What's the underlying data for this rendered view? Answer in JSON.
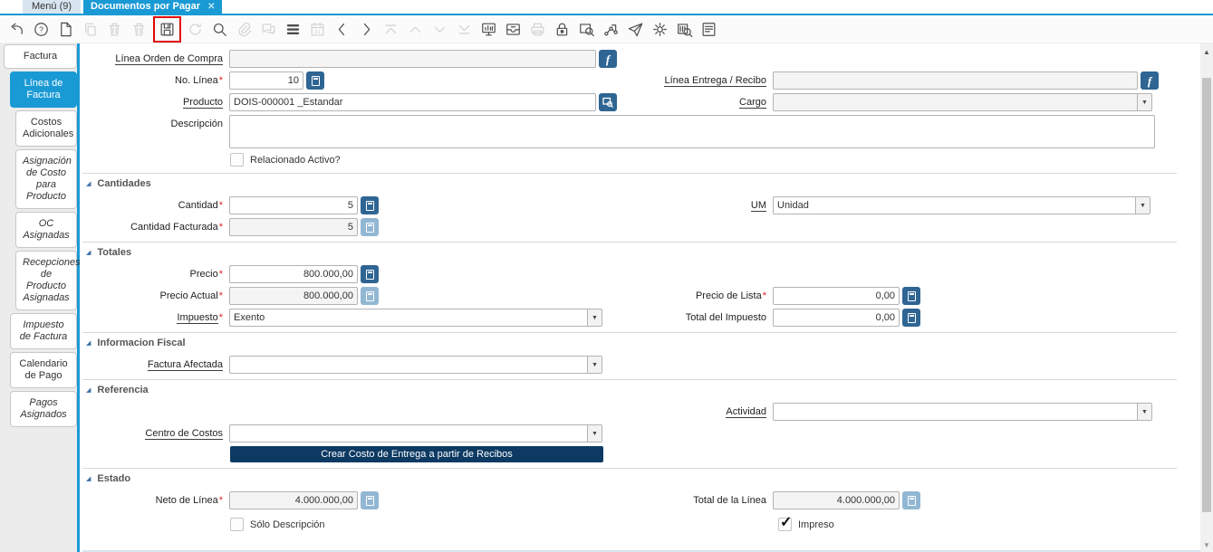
{
  "ui": {
    "close_glyph": "✕",
    "required_marker": "*",
    "check_glyph": "✓",
    "collapse_glyph": "◢",
    "combo_arrow": "▼",
    "scroll_up_glyph": "▲",
    "scroll_down_glyph": "▼",
    "zoom_button_glyph": "f"
  },
  "colors": {
    "accent_blue": "#1a9ad5",
    "field_button_blue": "#2f6593",
    "field_button_blue_disabled": "#92b7d3",
    "action_button_navy": "#0d3a63",
    "save_highlight_red": "#e00909"
  },
  "window_tabs": [
    {
      "label": "Menú (9)",
      "active": false
    },
    {
      "label": "Documentos por Pagar",
      "active": true,
      "closable": true
    }
  ],
  "toolbar": {
    "icons": [
      {
        "name": "undo-icon",
        "key": "undo",
        "enabled": true
      },
      {
        "name": "help-icon",
        "key": "help",
        "enabled": true
      },
      {
        "name": "new-record-icon",
        "key": "new",
        "enabled": true
      },
      {
        "name": "copy-record-icon",
        "key": "copy",
        "enabled": false
      },
      {
        "name": "delete-record-icon",
        "key": "delete",
        "enabled": false
      },
      {
        "name": "delete-selection-icon",
        "key": "delete",
        "enabled": false
      },
      {
        "name": "save-icon",
        "key": "save",
        "enabled": true,
        "highlighted": true
      },
      {
        "name": "refresh-icon",
        "key": "refresh",
        "enabled": false
      },
      {
        "name": "find-icon",
        "key": "find",
        "enabled": true
      },
      {
        "name": "attachment-icon",
        "key": "attachment",
        "enabled": false
      },
      {
        "name": "chat-icon",
        "key": "chat",
        "enabled": false
      },
      {
        "name": "grid-toggle-icon",
        "key": "grid",
        "enabled": true
      },
      {
        "name": "calendar-icon",
        "key": "calendar",
        "enabled": false
      },
      {
        "name": "parent-record-icon",
        "key": "parent",
        "enabled": true
      },
      {
        "name": "detail-record-icon",
        "key": "detail",
        "enabled": true
      },
      {
        "name": "first-record-icon",
        "key": "first",
        "enabled": false
      },
      {
        "name": "previous-record-icon",
        "key": "prev",
        "enabled": false
      },
      {
        "name": "next-record-icon",
        "key": "next",
        "enabled": false
      },
      {
        "name": "last-record-icon",
        "key": "last",
        "enabled": false
      },
      {
        "name": "report-icon",
        "key": "report",
        "enabled": true
      },
      {
        "name": "archive-icon",
        "key": "archive",
        "enabled": true
      },
      {
        "name": "print-icon",
        "key": "print",
        "enabled": false
      },
      {
        "name": "lock-icon",
        "key": "lock",
        "enabled": true
      },
      {
        "name": "zoom-across-icon",
        "key": "zoomacross",
        "enabled": true
      },
      {
        "name": "workflow-icon",
        "key": "workflow",
        "enabled": true
      },
      {
        "name": "send-icon",
        "key": "send",
        "enabled": true
      },
      {
        "name": "process-icon",
        "key": "process",
        "enabled": true
      },
      {
        "name": "product-info-icon",
        "key": "productinfo",
        "enabled": true
      },
      {
        "name": "report-design-icon",
        "key": "reportdoc",
        "enabled": true
      }
    ]
  },
  "sidebar": {
    "tabs": [
      {
        "label": "Factura",
        "level": 0,
        "active": false,
        "italic": false
      },
      {
        "label": "Línea de Factura",
        "level": 1,
        "active": true,
        "italic": false
      },
      {
        "label": "Costos Adicionales",
        "level": 2,
        "active": false,
        "italic": false
      },
      {
        "label": "Asignación de Costo para Producto",
        "level": 2,
        "active": false,
        "italic": true
      },
      {
        "label": "OC Asignadas",
        "level": 2,
        "active": false,
        "italic": true
      },
      {
        "label": "Recepciones de Producto Asignadas",
        "level": 2,
        "active": false,
        "italic": true
      },
      {
        "label": "Impuesto de Factura",
        "level": 1,
        "active": false,
        "italic": true
      },
      {
        "label": "Calendario de Pago",
        "level": 1,
        "active": false,
        "italic": false
      },
      {
        "label": "Pagos Asignados",
        "level": 1,
        "active": false,
        "italic": true
      }
    ]
  },
  "form": {
    "sections": {
      "cantidades": "Cantidades",
      "totales": "Totales",
      "informacion_fiscal": "Informacion Fiscal",
      "referencia": "Referencia",
      "estado": "Estado"
    },
    "fields": {
      "linea_orden_compra": {
        "label": "Línea Orden de Compra",
        "value": ""
      },
      "no_linea": {
        "label": "No. Línea",
        "value": "10"
      },
      "linea_entrega": {
        "label": "Línea Entrega / Recibo",
        "value": ""
      },
      "producto": {
        "label": "Producto",
        "value": "DOIS-000001 _Estandar"
      },
      "cargo": {
        "label": "Cargo",
        "value": ""
      },
      "descripcion": {
        "label": "Descripción",
        "value": ""
      },
      "relacionado_activo": {
        "label": "Relacionado Activo?",
        "checked": false
      },
      "cantidad": {
        "label": "Cantidad",
        "value": "5"
      },
      "um": {
        "label": "UM",
        "value": "Unidad"
      },
      "cantidad_facturada": {
        "label": "Cantidad Facturada",
        "value": "5"
      },
      "precio": {
        "label": "Precio",
        "value": "800.000,00"
      },
      "precio_actual": {
        "label": "Precio Actual",
        "value": "800.000,00"
      },
      "precio_lista": {
        "label": "Precio de Lista",
        "value": "0,00"
      },
      "impuesto": {
        "label": "Impuesto",
        "value": "Exento"
      },
      "total_impuesto": {
        "label": "Total del Impuesto",
        "value": "0,00"
      },
      "factura_afectada": {
        "label": "Factura Afectada",
        "value": ""
      },
      "actividad": {
        "label": "Actividad",
        "value": ""
      },
      "centro_costos": {
        "label": "Centro de Costos",
        "value": ""
      },
      "neto_linea": {
        "label": "Neto de Línea",
        "value": "4.000.000,00"
      },
      "total_linea": {
        "label": "Total de la Línea",
        "value": "4.000.000,00"
      },
      "solo_descripcion": {
        "label": "Sólo Descripción",
        "checked": false
      },
      "impreso": {
        "label": "Impreso",
        "checked": true
      }
    },
    "buttons": {
      "crear_costo": "Crear Costo de Entrega a partir de Recibos"
    }
  }
}
